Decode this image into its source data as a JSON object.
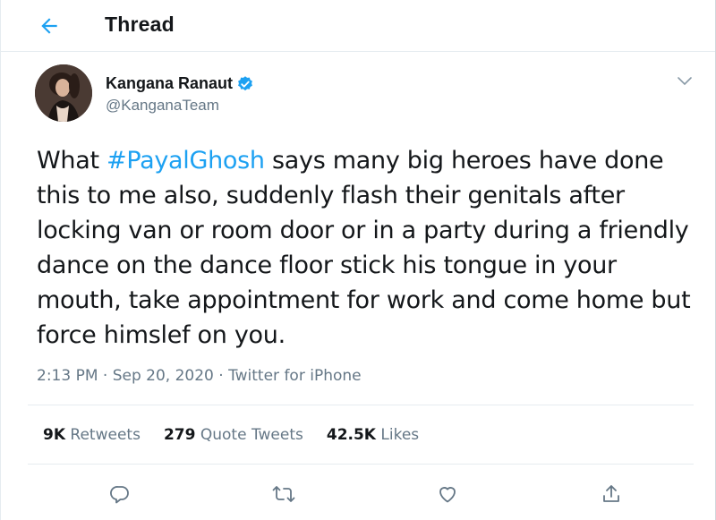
{
  "header": {
    "title": "Thread",
    "back_icon": "arrow-left-icon"
  },
  "author": {
    "name": "Kangana Ranaut",
    "handle": "@KanganaTeam",
    "verified": true
  },
  "tweet": {
    "text_before": "What ",
    "hashtag": "#PayalGhosh",
    "text_after": " says many big heroes have done this to me also, suddenly flash their genitals after locking van or room door or in a party during a friendly dance on the dance floor stick his tongue in your mouth, take appointment for work and come home but force himslef on you."
  },
  "meta": {
    "line": "2:13 PM · Sep 20, 2020 · Twitter for iPhone"
  },
  "stats": {
    "retweets": {
      "count": "9K",
      "label": "Retweets"
    },
    "quotes": {
      "count": "279",
      "label": "Quote Tweets"
    },
    "likes": {
      "count": "42.5K",
      "label": "Likes"
    }
  },
  "actions": [
    "reply-icon",
    "retweet-icon",
    "like-icon",
    "share-icon"
  ],
  "colors": {
    "accent": "#1da1f2",
    "text": "#14171a",
    "secondary": "#657786",
    "border": "#e6ecf0"
  }
}
